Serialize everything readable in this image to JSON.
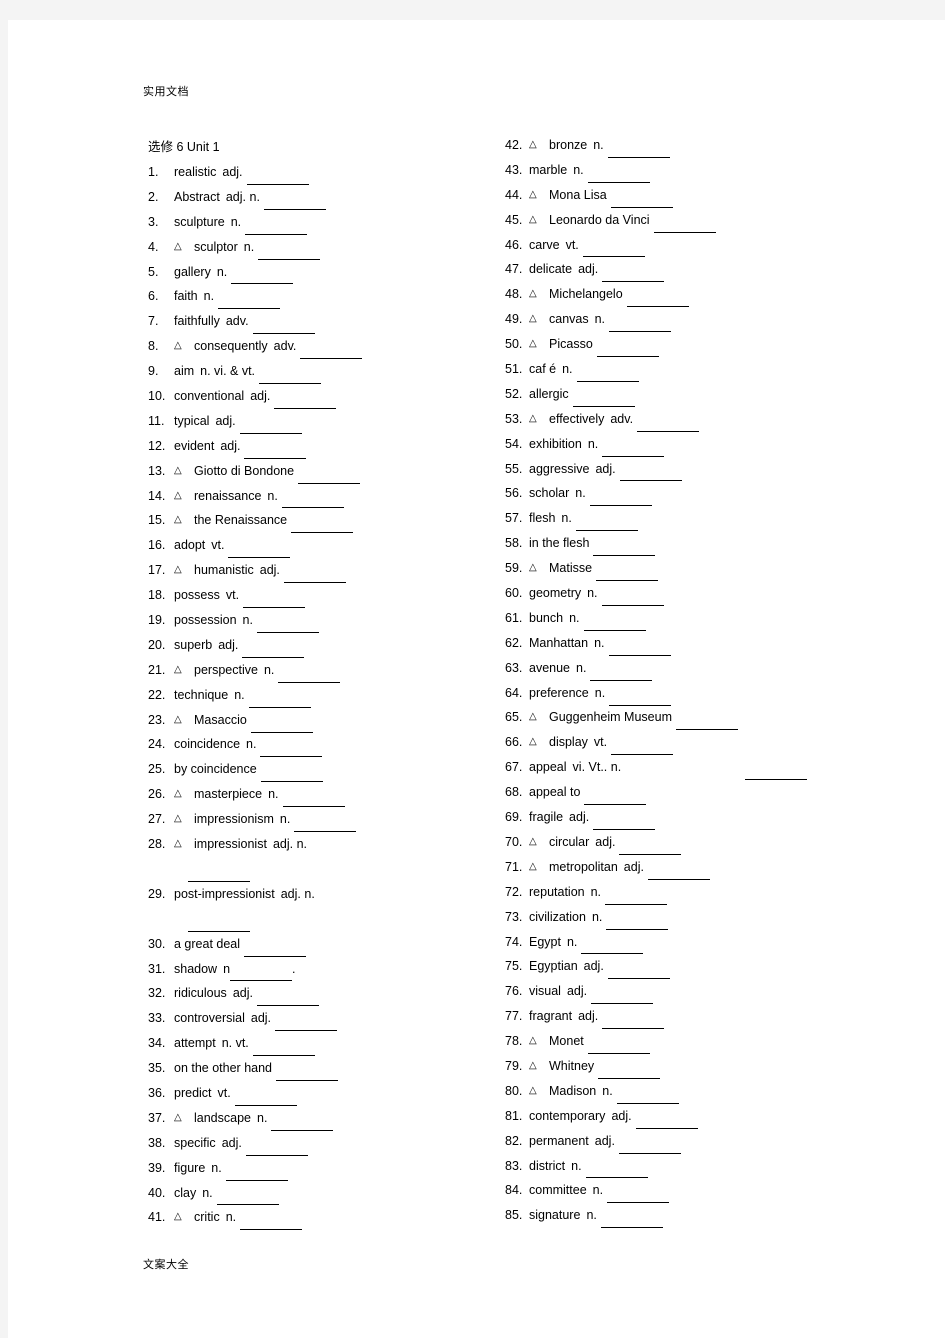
{
  "header_note": "实用文档",
  "footer_note": "文案大全",
  "unit_title": "选修  6    Unit 1",
  "left_column": [
    {
      "num": "1.",
      "tri": "",
      "word": "realistic",
      "pos": "adj."
    },
    {
      "num": "2.",
      "tri": "",
      "word": "Abstract",
      "pos": "adj. n."
    },
    {
      "num": "3.",
      "tri": "",
      "word": "sculpture",
      "pos": "n."
    },
    {
      "num": "4.",
      "tri": "△",
      "word": "sculptor",
      "pos": "n."
    },
    {
      "num": "5.",
      "tri": "",
      "word": "gallery",
      "pos": "n."
    },
    {
      "num": "6.",
      "tri": "",
      "word": "faith",
      "pos": "n."
    },
    {
      "num": "7.",
      "tri": "",
      "word": "faithfully",
      "pos": "adv."
    },
    {
      "num": "8.",
      "tri": "△",
      "word": "consequently",
      "pos": "adv."
    },
    {
      "num": "9.",
      "tri": "",
      "word": "aim",
      "pos": "n.  vi. & vt."
    },
    {
      "num": "10.",
      "tri": "",
      "word": "conventional",
      "pos": "adj."
    },
    {
      "num": "11.",
      "tri": "",
      "word": "typical",
      "pos": "adj."
    },
    {
      "num": "12.",
      "tri": "",
      "word": "evident",
      "pos": "adj."
    },
    {
      "num": "13.",
      "tri": "△",
      "word": "Giotto di Bondone",
      "pos": ""
    },
    {
      "num": "14.",
      "tri": "△",
      "word": "renaissance",
      "pos": "n."
    },
    {
      "num": "15.",
      "tri": "△",
      "word": "the Renaissance",
      "pos": ""
    },
    {
      "num": "16.",
      "tri": "",
      "word": "adopt",
      "pos": "vt."
    },
    {
      "num": "17.",
      "tri": "△",
      "word": "humanistic",
      "pos": "adj."
    },
    {
      "num": "18.",
      "tri": "",
      "word": "possess",
      "pos": "vt."
    },
    {
      "num": "19.",
      "tri": "",
      "word": "possession",
      "pos": "n."
    },
    {
      "num": "20.",
      "tri": "",
      "word": "superb",
      "pos": "adj."
    },
    {
      "num": "21.",
      "tri": "△",
      "word": "perspective",
      "pos": "n."
    },
    {
      "num": "22.",
      "tri": "",
      "word": "technique",
      "pos": "n."
    },
    {
      "num": "23.",
      "tri": "△",
      "word": "Masaccio",
      "pos": ""
    },
    {
      "num": "24.",
      "tri": "",
      "word": "coincidence",
      "pos": "n."
    },
    {
      "num": "25.",
      "tri": "",
      "word": "by coincidence",
      "pos": ""
    },
    {
      "num": "26.",
      "tri": "△",
      "word": "masterpiece",
      "pos": "n."
    },
    {
      "num": "27.",
      "tri": "△",
      "word": "impressionism",
      "pos": "n."
    },
    {
      "num": "28.",
      "tri": "△",
      "word": "impressionist",
      "pos": "adj.            n.",
      "wrap": true
    },
    {
      "num": "29.",
      "tri": "",
      "word": "post-impressionist",
      "pos": "adj.            n.",
      "wrap": true
    },
    {
      "num": "30.",
      "tri": "",
      "word": "a great deal",
      "pos": ""
    },
    {
      "num": "31.",
      "tri": "",
      "word": "shadow",
      "pos": "n",
      "tight": true
    },
    {
      "num": "32.",
      "tri": "",
      "word": "ridiculous",
      "pos": "adj."
    },
    {
      "num": "33.",
      "tri": "",
      "word": "controversial",
      "pos": "adj."
    },
    {
      "num": "34.",
      "tri": "",
      "word": "attempt",
      "pos": "n.       vt."
    },
    {
      "num": "35.",
      "tri": "",
      "word": "on the other hand",
      "pos": ""
    },
    {
      "num": "36.",
      "tri": "",
      "word": "predict",
      "pos": "vt."
    },
    {
      "num": "37.",
      "tri": "△",
      "word": "landscape",
      "pos": "n."
    },
    {
      "num": "38.",
      "tri": "",
      "word": "specific",
      "pos": "adj."
    },
    {
      "num": "39.",
      "tri": "",
      "word": "figure",
      "pos": "n."
    },
    {
      "num": "40.",
      "tri": "",
      "word": "clay",
      "pos": "n."
    },
    {
      "num": "41.",
      "tri": "△",
      "word": "critic",
      "pos": "n."
    }
  ],
  "right_column": [
    {
      "num": "42.",
      "tri": "△",
      "word": "bronze",
      "pos": "n."
    },
    {
      "num": "43.",
      "tri": "",
      "word": "marble",
      "pos": "n."
    },
    {
      "num": "44.",
      "tri": "△",
      "word": "Mona Lisa",
      "pos": ""
    },
    {
      "num": "45.",
      "tri": "△",
      "word": "Leonardo da Vinci",
      "pos": ""
    },
    {
      "num": "46.",
      "tri": "",
      "word": "carve",
      "pos": "vt."
    },
    {
      "num": "47.",
      "tri": "",
      "word": "delicate",
      "pos": "adj."
    },
    {
      "num": "48.",
      "tri": "△",
      "word": "Michelangelo",
      "pos": ""
    },
    {
      "num": "49.",
      "tri": "△",
      "word": "canvas",
      "pos": "n."
    },
    {
      "num": "50.",
      "tri": "△",
      "word": "Picasso",
      "pos": ""
    },
    {
      "num": "51.",
      "tri": "",
      "word": "caf é",
      "pos": "n."
    },
    {
      "num": "52.",
      "tri": "",
      "word": "allergic",
      "pos": ""
    },
    {
      "num": "53.",
      "tri": "△",
      "word": "effectively",
      "pos": "adv."
    },
    {
      "num": "54.",
      "tri": "",
      "word": "exhibition",
      "pos": "n."
    },
    {
      "num": "55.",
      "tri": "",
      "word": "aggressive",
      "pos": "adj."
    },
    {
      "num": "56.",
      "tri": "",
      "word": "scholar",
      "pos": "n."
    },
    {
      "num": "57.",
      "tri": "",
      "word": "flesh",
      "pos": "n."
    },
    {
      "num": "58.",
      "tri": "",
      "word": "in the flesh",
      "pos": ""
    },
    {
      "num": "59.",
      "tri": "△",
      "word": "Matisse",
      "pos": ""
    },
    {
      "num": "60.",
      "tri": "",
      "word": "geometry",
      "pos": "n."
    },
    {
      "num": "61.",
      "tri": "",
      "word": "bunch",
      "pos": "n."
    },
    {
      "num": "62.",
      "tri": "",
      "word": "Manhattan",
      "pos": "n."
    },
    {
      "num": "63.",
      "tri": "",
      "word": "avenue",
      "pos": "n."
    },
    {
      "num": "64.",
      "tri": "",
      "word": "preference",
      "pos": "n."
    },
    {
      "num": "65.",
      "tri": "△",
      "word": "Guggenheim Museum",
      "pos": ""
    },
    {
      "num": "66.",
      "tri": "△",
      "word": "display",
      "pos": "vt."
    },
    {
      "num": "67.",
      "tri": "",
      "word": "appeal",
      "pos": "vi. Vt..  n.",
      "far": true
    },
    {
      "num": "68.",
      "tri": "",
      "word": "appeal to",
      "pos": ""
    },
    {
      "num": "69.",
      "tri": "",
      "word": "fragile",
      "pos": "adj."
    },
    {
      "num": "70.",
      "tri": "△",
      "word": "circular",
      "pos": "adj."
    },
    {
      "num": "71.",
      "tri": "△",
      "word": "metropolitan",
      "pos": "adj."
    },
    {
      "num": "72.",
      "tri": "",
      "word": "reputation",
      "pos": "n."
    },
    {
      "num": "73.",
      "tri": "",
      "word": "civilization",
      "pos": "n."
    },
    {
      "num": "74.",
      "tri": "",
      "word": "Egypt",
      "pos": "n."
    },
    {
      "num": "75.",
      "tri": "",
      "word": "Egyptian",
      "pos": "adj."
    },
    {
      "num": "76.",
      "tri": "",
      "word": "visual",
      "pos": "adj."
    },
    {
      "num": "77.",
      "tri": "",
      "word": "fragrant",
      "pos": "adj."
    },
    {
      "num": "78.",
      "tri": "△",
      "word": "Monet",
      "pos": ""
    },
    {
      "num": "79.",
      "tri": "△",
      "word": "Whitney",
      "pos": ""
    },
    {
      "num": "80.",
      "tri": "△",
      "word": "Madison",
      "pos": "n."
    },
    {
      "num": "81.",
      "tri": "",
      "word": "contemporary",
      "pos": "adj."
    },
    {
      "num": "82.",
      "tri": "",
      "word": "permanent",
      "pos": "adj."
    },
    {
      "num": "83.",
      "tri": "",
      "word": "district",
      "pos": "n."
    },
    {
      "num": "84.",
      "tri": "",
      "word": "committee",
      "pos": "n."
    },
    {
      "num": "85.",
      "tri": "",
      "word": "signature",
      "pos": "n."
    }
  ]
}
